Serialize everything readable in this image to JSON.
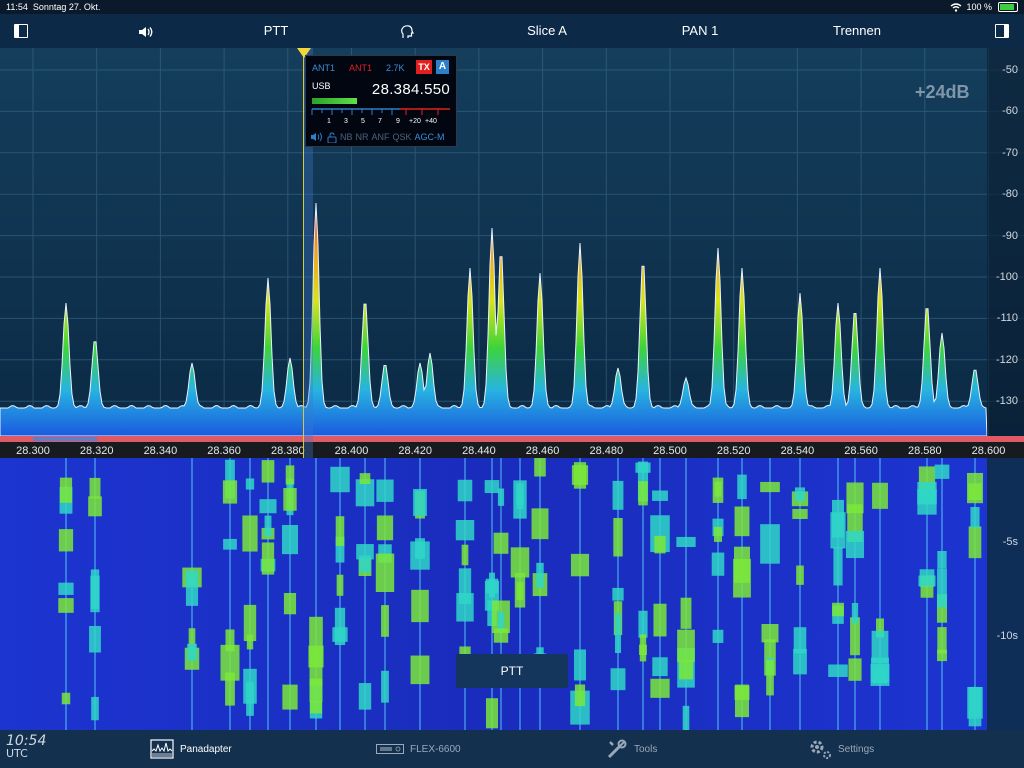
{
  "status": {
    "time": "11:54",
    "date": "Sonntag 27. Okt.",
    "battery": "100 %",
    "battery_level": 1.0
  },
  "toolbar": {
    "ptt": "PTT",
    "slice": "Slice A",
    "pan": "PAN 1",
    "disconnect": "Trennen"
  },
  "panadapter": {
    "gain": "+24dB",
    "db_labels": [
      "-50",
      "-60",
      "-70",
      "-80",
      "-90",
      "-100",
      "-110",
      "-120",
      "-130"
    ],
    "freq_labels": [
      "28.300",
      "28.320",
      "28.340",
      "28.360",
      "28.380",
      "28.400",
      "28.420",
      "28.440",
      "28.460",
      "28.480",
      "28.500",
      "28.520",
      "28.540",
      "28.560",
      "28.580",
      "28.600"
    ]
  },
  "slice_flag": {
    "rx_ant": "ANT1",
    "tx_ant": "ANT1",
    "bandwidth": "2.7K",
    "tx_badge": "TX",
    "slice_letter": "A",
    "mode": "USB",
    "frequency": "28.384.550",
    "meter_ticks": [
      "1",
      "3",
      "5",
      "7",
      "9",
      "+20",
      "+40"
    ],
    "dsp": [
      "NB",
      "NR",
      "ANF",
      "QSK",
      "AGC-M"
    ]
  },
  "waterfall": {
    "time_labels": [
      "-5s",
      "-10s"
    ],
    "ptt_button": "PTT"
  },
  "clock": {
    "time": "10:54",
    "zone": "UTC"
  },
  "tabs": [
    {
      "label": "Panadapter",
      "icon": "panadapter-icon"
    },
    {
      "label": "FLEX-6600",
      "icon": "radio-icon"
    },
    {
      "label": "Tools",
      "icon": "tools-icon"
    },
    {
      "label": "Settings",
      "icon": "settings-gear-icon"
    }
  ],
  "colors": {
    "accent": "#3a8fd8",
    "tx_red": "#e02020",
    "cursor": "#f3d53c"
  }
}
